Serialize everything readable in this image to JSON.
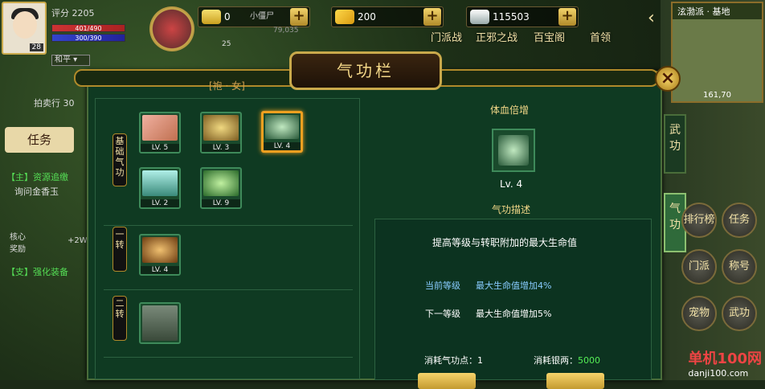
{
  "player": {
    "score_label": "评分",
    "score": "2205",
    "hp": "401/490",
    "mp": "300/390",
    "level": "28",
    "mode": "和平"
  },
  "pet": {
    "level": "25"
  },
  "currency": [
    {
      "value": "0",
      "extra": "小僵尸"
    },
    {
      "value": "200"
    },
    {
      "value": "115503"
    }
  ],
  "faint": "79,035",
  "top_menu": [
    "门派战",
    "正邪之战",
    "百宝阁",
    "首领"
  ],
  "minimap": {
    "title": "泫渤派 · 基地",
    "coords": "161,70"
  },
  "left": {
    "auction": "拍卖行",
    "auction_num": "30",
    "task_btn": "任务",
    "quest1": "【主】资源追缴",
    "quest1b": "询问金香玉",
    "quest2": "核心奖励",
    "quest2b": "+2W",
    "quest3": "【支】强化装备"
  },
  "panel": {
    "title": "气功栏",
    "subtitle": "[袍 · 女]"
  },
  "sections": [
    {
      "label": "基础气功",
      "skills": [
        {
          "lv": "LV. 5"
        },
        {
          "lv": "LV. 3"
        },
        {
          "lv": "LV. 4"
        },
        {
          "lv": "LV. 2"
        },
        {
          "lv": "LV. 9"
        }
      ]
    },
    {
      "label": "一转",
      "skills": [
        {
          "lv": "LV. 4"
        }
      ]
    },
    {
      "label": "二转",
      "skills": [
        {
          "lv": ""
        }
      ]
    }
  ],
  "detail": {
    "name": "体血倍增",
    "level": "Lv. 4",
    "desc_title": "气功描述",
    "desc": "提高等级与转职附加的最大生命值",
    "cur_label": "当前等级",
    "cur_val": "最大生命值增加4%",
    "next_label": "下一等级",
    "next_val": "最大生命值增加5%",
    "cost_pts_label": "消耗气功点：",
    "cost_pts": "1",
    "cost_silver_label": "消耗银两：",
    "cost_silver": "5000"
  },
  "tabs": [
    "武功",
    "气功"
  ],
  "side_buttons": [
    "排行榜",
    "任务",
    "门派",
    "称号",
    "宠物",
    "武功"
  ],
  "watermark": {
    "main": "单机100网",
    "sub": "danji100.com"
  }
}
